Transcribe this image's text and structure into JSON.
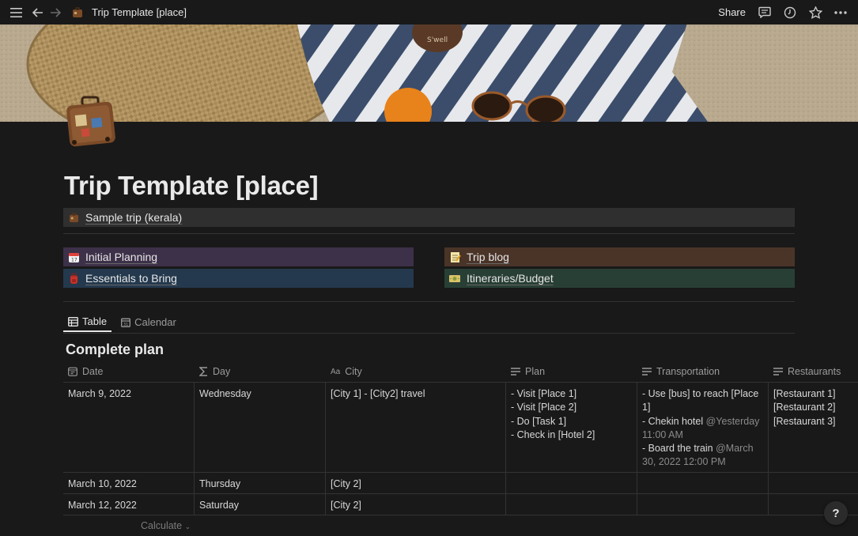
{
  "topbar": {
    "title": "Trip Template [place]",
    "share_label": "Share"
  },
  "page": {
    "title": "Trip Template [place]",
    "icon": "suitcase-icon"
  },
  "sample_link": {
    "label": "Sample trip (kerala)",
    "icon": "suitcase-icon"
  },
  "callouts": [
    {
      "label": "Initial Planning",
      "icon": "calendar-icon",
      "color": "#3d3049"
    },
    {
      "label": "Trip blog",
      "icon": "memo-icon",
      "color": "#4a3428"
    },
    {
      "label": "Essentials to Bring",
      "icon": "backpack-icon",
      "color": "#24394e"
    },
    {
      "label": "Itineraries/Budget",
      "icon": "money-icon",
      "color": "#283f35"
    }
  ],
  "tabs": [
    {
      "label": "Table",
      "active": true,
      "icon": "table-icon"
    },
    {
      "label": "Calendar",
      "active": false,
      "icon": "calendar-view-icon"
    }
  ],
  "database": {
    "title": "Complete plan",
    "columns": [
      {
        "label": "Date",
        "icon": "calendar-property-icon"
      },
      {
        "label": "Day",
        "icon": "sigma-icon"
      },
      {
        "label": "City",
        "icon": "text-property-icon"
      },
      {
        "label": "Plan",
        "icon": "lines-icon"
      },
      {
        "label": "Transportation",
        "icon": "lines-icon"
      },
      {
        "label": "Restaurants",
        "icon": "lines-icon"
      }
    ],
    "rows": [
      {
        "date": "March 9, 2022",
        "day": "Wednesday",
        "city": "[City 1] - [City2] travel",
        "plan": [
          "- Visit [Place 1]",
          "- Visit [Place 2]",
          "- Do [Task 1]",
          "- Check in [Hotel 2]"
        ],
        "transportation": {
          "line1": "- Use [bus] to reach [Place 1]",
          "line2_text": "- Chekin hotel ",
          "line2_mention": "@Yesterday 11:00 AM",
          "line3_text": "- Board the train ",
          "line3_mention": "@March 30, 2022 12:00 PM"
        },
        "restaurants": [
          "[Restaurant 1]",
          "[Restaurant 2]",
          "[Restaurant 3]"
        ]
      },
      {
        "date": "March 10, 2022",
        "day": "Thursday",
        "city": "[City 2]"
      },
      {
        "date": "March 12, 2022",
        "day": "Saturday",
        "city": "[City 2]"
      }
    ],
    "calculate_label": "Calculate"
  },
  "help_label": "?"
}
